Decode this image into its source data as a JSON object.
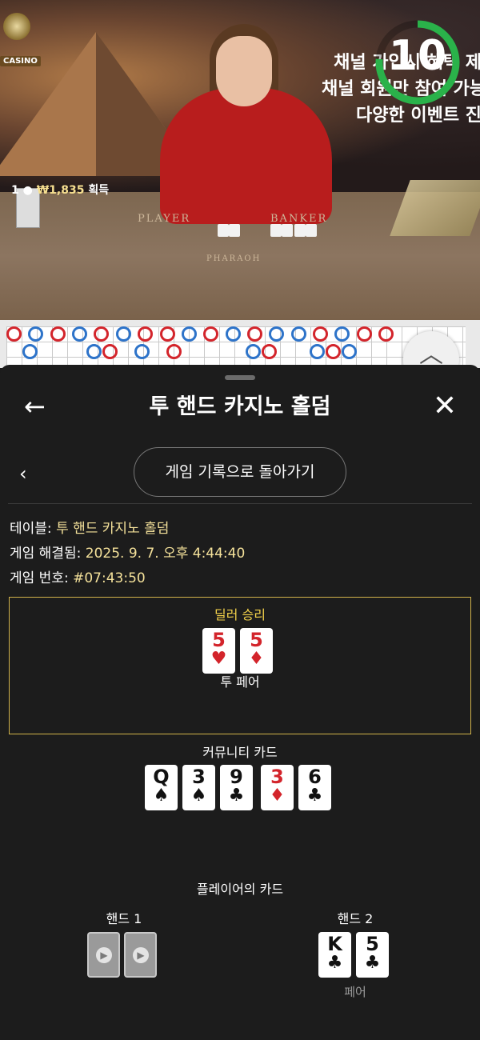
{
  "video": {
    "logo_text": "CASINO",
    "winner_count": "1",
    "winner_amount": "₩1,835",
    "winner_suffix": "획득",
    "promo_lines": [
      "채널 가입시 혜택 제",
      "채널 회원만 참여 가능",
      "다양한 이벤트 진"
    ],
    "timer": "10",
    "table_left_label": "PLAYER",
    "table_right_label": "BANKER",
    "table_bottom_label": "PHARAOH",
    "timer_color": "#2ab24a"
  },
  "roadmap": {
    "colors": {
      "red": "#d3242b",
      "blue": "#2d73c9"
    },
    "row1": [
      "red",
      "blue",
      "red",
      "blue",
      "red",
      "blue",
      "red",
      "red",
      "blue",
      "red",
      "blue",
      "red",
      "blue",
      "blue",
      "red",
      "blue",
      "red",
      "red"
    ],
    "row2": [
      "blue",
      "blue",
      "red",
      "blue",
      "red",
      "blue",
      "red",
      "blue",
      "red",
      "blue"
    ],
    "scroll_icon": "chevron-up-icon"
  },
  "panel": {
    "title": "투 핸드 카지노 홀덤",
    "back_icon": "arrow-left-icon",
    "close_icon": "close-icon",
    "history_button": "게임 기록으로 돌아가기",
    "table_label": "테이블:",
    "table_value": "투 핸드 카지노 홀덤",
    "resolved_label": "게임 해결됨:",
    "resolved_value": "2025. 9. 7. 오후 4:44:40",
    "game_no_label": "게임 번호:",
    "game_no_value": "#07:43:50",
    "accent_color": "#d0b34a"
  },
  "dealer": {
    "result": "딜러 승리",
    "hand_name": "투 페어",
    "cards": [
      {
        "rank": "5",
        "suit": "♥",
        "color": "red"
      },
      {
        "rank": "5",
        "suit": "♦",
        "color": "red"
      }
    ]
  },
  "community": {
    "label": "커뮤니티 카드",
    "cards": [
      {
        "rank": "Q",
        "suit": "♠",
        "color": "black"
      },
      {
        "rank": "3",
        "suit": "♠",
        "color": "black"
      },
      {
        "rank": "9",
        "suit": "♣",
        "color": "black"
      },
      {
        "rank": "3",
        "suit": "♦",
        "color": "red"
      },
      {
        "rank": "6",
        "suit": "♣",
        "color": "black"
      }
    ]
  },
  "player": {
    "label": "플레이어의 카드",
    "hand1_label": "핸드 1",
    "hand2_label": "핸드 2",
    "hand2_result": "페어",
    "hand2_cards": [
      {
        "rank": "K",
        "suit": "♣",
        "color": "black"
      },
      {
        "rank": "5",
        "suit": "♣",
        "color": "black"
      }
    ]
  }
}
